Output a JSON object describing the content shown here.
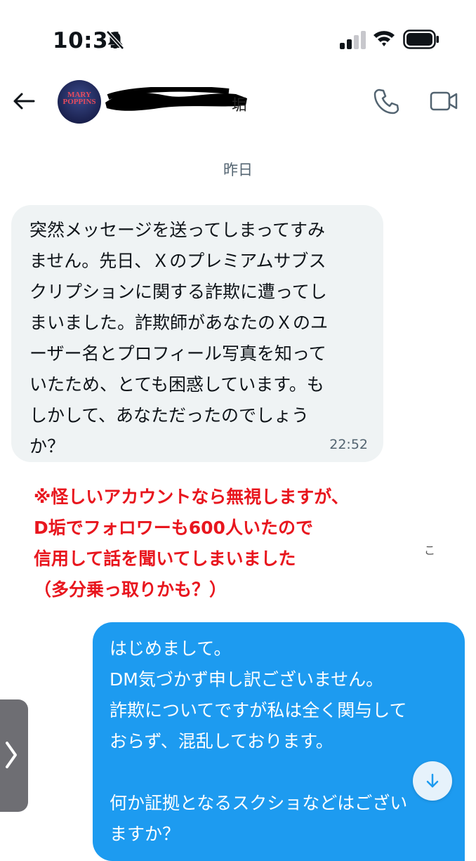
{
  "status_bar": {
    "time": "10:31"
  },
  "conversation": {
    "avatar_alt": "MARY POPPINS",
    "name_tail": "垢"
  },
  "date_label": "昨日",
  "incoming_message": {
    "text": "突然メッセージを送ってしまってすみ\nません。先日、Ｘのプレミアムサブス\nクリプションに関する詐欺に遭ってし\nまいました。詐欺師があなたのＸのユ\nーザー名とプロフィール写真を知って\nいたため、とても困惑しています。も\nしかして、あなただったのでしょう\nか？",
    "time": "22:52"
  },
  "annotation": {
    "lines": [
      "※怪しいアカウントなら無視しますが、",
      "D垢でフォロワーも600人いたので",
      "信用して話を聞いてしまいました",
      "（多分乗っ取りかも？）"
    ]
  },
  "fragment_text": "こ",
  "outgoing_message": {
    "text": "はじめまして。\nDM気づかず申し訳ございません。\n詐欺についてですが私は全く関与して\nおらず、混乱しております。\n\n何か証拠となるスクショなどはござい\nますか？"
  },
  "colors": {
    "accent": "#1d9bf0",
    "annotation_red": "#e8161e",
    "incoming_bg": "#eff3f4",
    "secondary_text": "#536471"
  },
  "icons": {
    "back": "back-arrow-icon",
    "phone": "phone-icon",
    "video": "video-camera-icon",
    "scroll": "arrow-down-icon",
    "tab": "chevron-right-icon"
  }
}
